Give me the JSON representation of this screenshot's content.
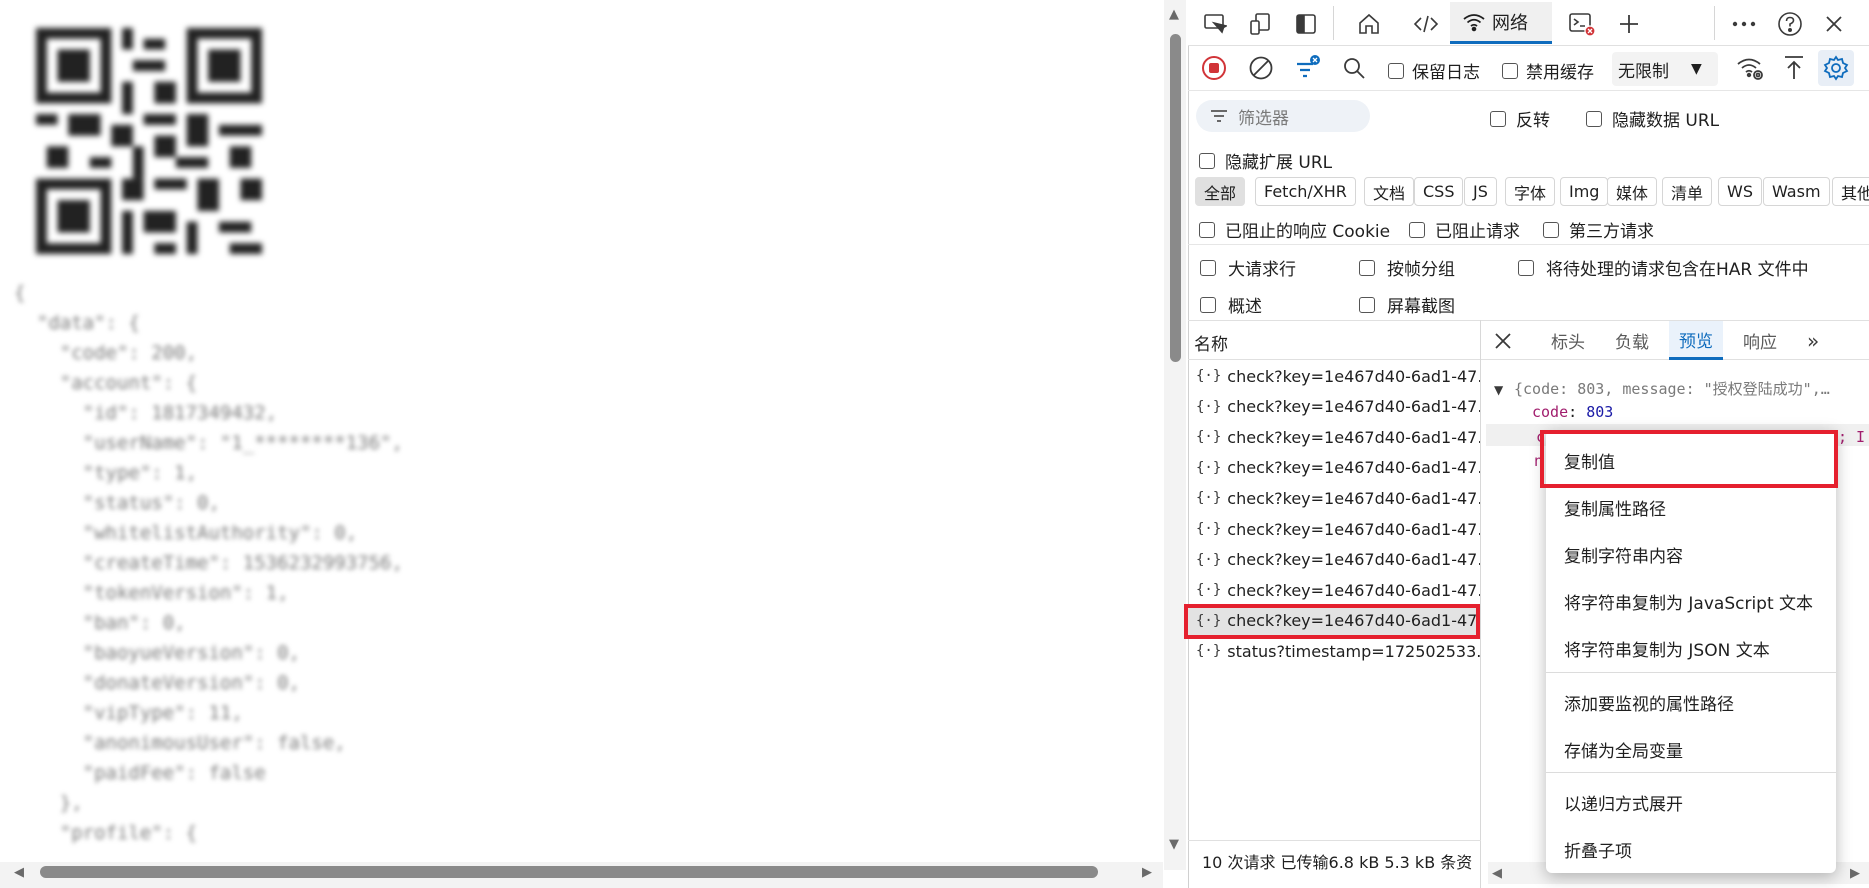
{
  "page": {
    "json_preview_lines": [
      "{",
      "  \"data\": {",
      "    \"code\": 200,",
      "    \"account\": {",
      "      \"id\": 1817349432,",
      "      \"userName\": \"1_********136\",",
      "      \"type\": 1,",
      "      \"status\": 0,",
      "      \"whitelistAuthority\": 0,",
      "      \"createTime\": 1536232993756,",
      "      \"tokenVersion\": 1,",
      "      \"ban\": 0,",
      "      \"baoyueVersion\": 0,",
      "      \"donateVersion\": 0,",
      "      \"vipType\": 11,",
      "      \"anonimousUser\": false,",
      "      \"paidFee\": false",
      "    },",
      "    \"profile\": {"
    ]
  },
  "devtools": {
    "top_tabs": {
      "network_label": "网络"
    },
    "toolbar": {
      "preserve_log": "保留日志",
      "disable_cache": "禁用缓存",
      "throttle_value": "无限制"
    },
    "filter": {
      "placeholder": "筛选器",
      "invert": "反转",
      "hide_data_urls": "隐藏数据 URL",
      "hide_ext_urls": "隐藏扩展 URL"
    },
    "type_filters": [
      "全部",
      "Fetch/XHR",
      "文档",
      "CSS",
      "JS",
      "字体",
      "Img",
      "媒体",
      "清单",
      "WS",
      "Wasm",
      "其他"
    ],
    "blocked_options": {
      "blocked_cookies": "已阻止的响应 Cookie",
      "blocked_requests": "已阻止请求",
      "third_party": "第三方请求"
    },
    "settings": {
      "large_rows": "大请求行",
      "group_by_frame": "按帧分组",
      "har_pending": "将待处理的请求包含在HAR 文件中",
      "overview": "概述",
      "screenshots": "屏幕截图"
    },
    "request_list": {
      "header": "名称",
      "rows": [
        "check?key=1e467d40-6ad1-47...",
        "check?key=1e467d40-6ad1-47...",
        "check?key=1e467d40-6ad1-47...",
        "check?key=1e467d40-6ad1-47...",
        "check?key=1e467d40-6ad1-47...",
        "check?key=1e467d40-6ad1-47...",
        "check?key=1e467d40-6ad1-47...",
        "check?key=1e467d40-6ad1-47...",
        "check?key=1e467d40-6ad1-47...",
        "status?timestamp=172502533..."
      ],
      "selected_index": 8,
      "status": "10 次请求   已传输6.8 kB   5.3 kB 条资"
    },
    "detail_tabs": [
      "标头",
      "负载",
      "预览",
      "响应"
    ],
    "active_detail_tab": "预览",
    "preview": {
      "summary": "{code: 803, message: \"授权登陆成功\",…",
      "code_key": "code",
      "code_value": "803"
    },
    "context_menu": {
      "items": [
        "复制值",
        "复制属性路径",
        "复制字符串内容",
        "将字符串复制为 JavaScript 文本",
        "将字符串复制为 JSON 文本",
        "添加要监视的属性路径",
        "存储为全局变量",
        "以递归方式展开",
        "折叠子项"
      ]
    },
    "colors": {
      "accent": "#0f6cbd",
      "highlight_red": "#e5202e",
      "record_red": "#d13438"
    }
  }
}
